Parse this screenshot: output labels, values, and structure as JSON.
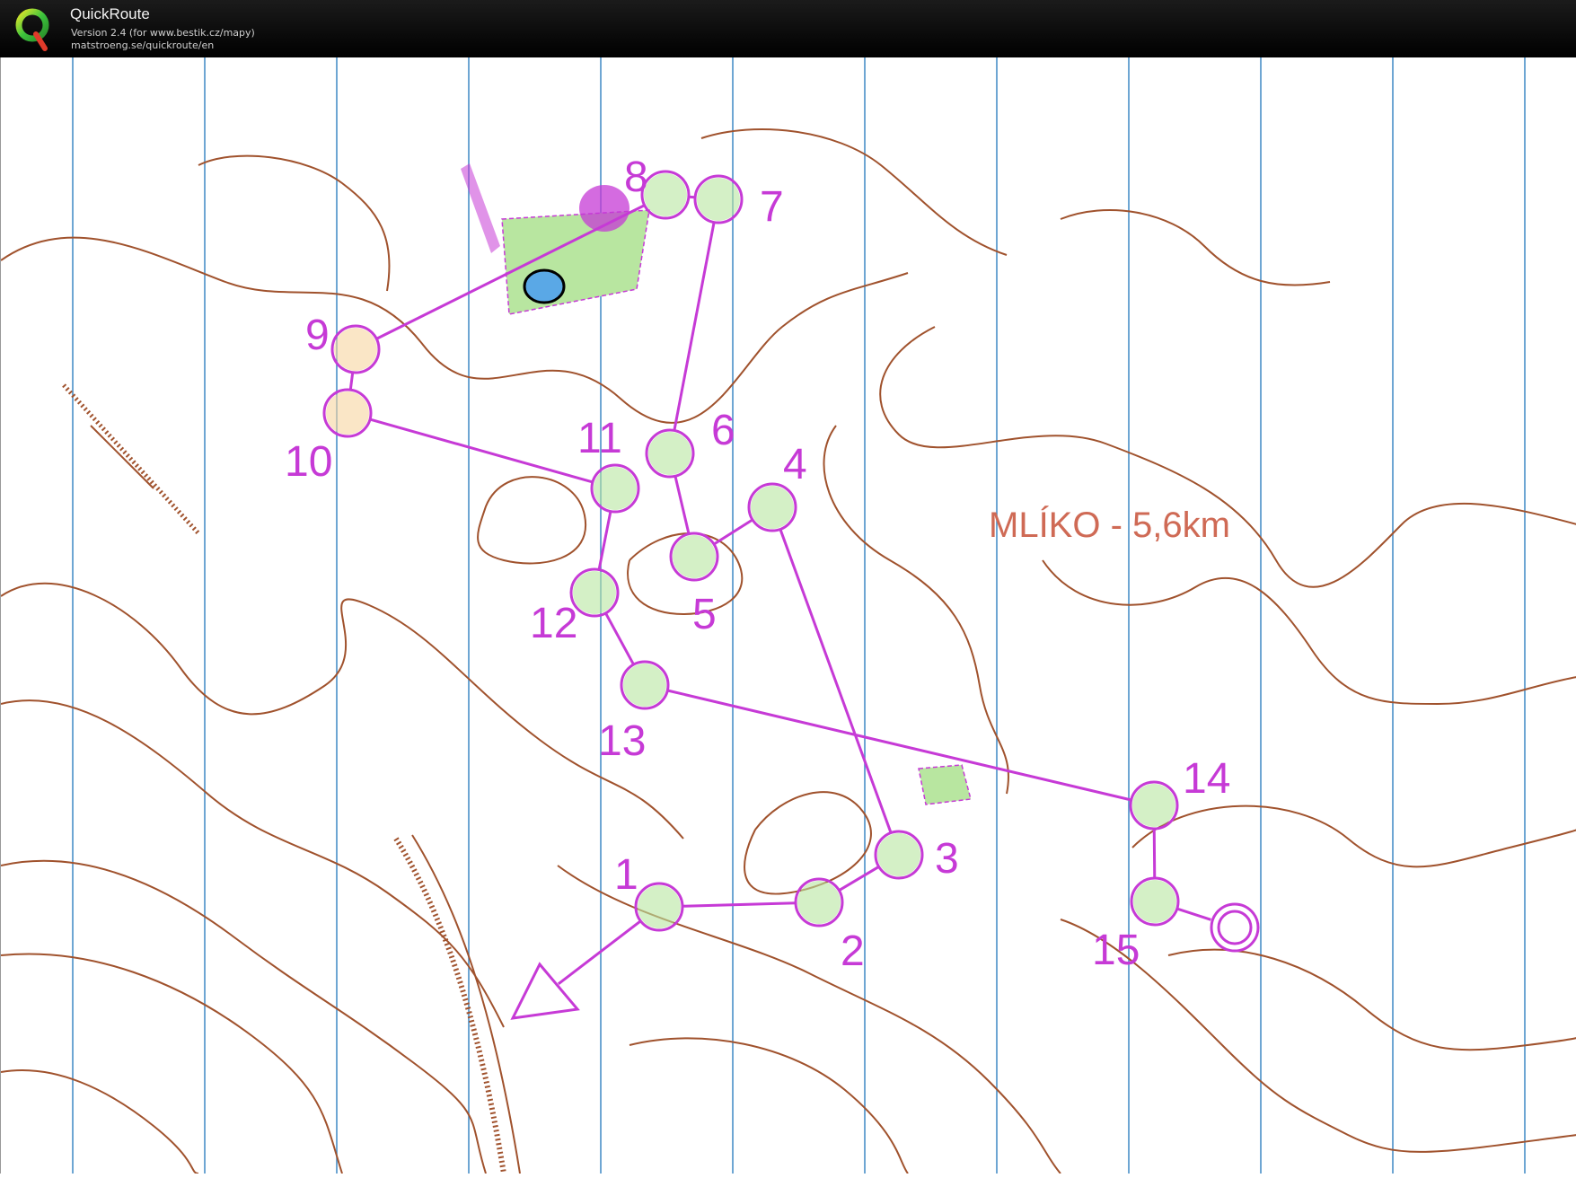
{
  "app": {
    "title": "QuickRoute",
    "version": "Version 2.4  (for www.bestik.cz/mapy)",
    "url": "matstroeng.se/quickroute/en",
    "logo": "quickroute-q-logo-icon"
  },
  "map": {
    "course_title": "MLÍKO - 5,6km",
    "colors": {
      "course": "#c63ad6",
      "contour": "#a0522d",
      "north_lines": "#4a90c8",
      "vegetation": "#b8e6a0",
      "open_land": "#f7d5a0",
      "water": "#5aa8e6",
      "title": "#cf6a55"
    },
    "start_label": "",
    "finish_label": "",
    "controls": [
      {
        "label": "1"
      },
      {
        "label": "2"
      },
      {
        "label": "3"
      },
      {
        "label": "4"
      },
      {
        "label": "5"
      },
      {
        "label": "6"
      },
      {
        "label": "7"
      },
      {
        "label": "8"
      },
      {
        "label": "9"
      },
      {
        "label": "10"
      },
      {
        "label": "11"
      },
      {
        "label": "12"
      },
      {
        "label": "13"
      },
      {
        "label": "14"
      },
      {
        "label": "15"
      }
    ]
  }
}
